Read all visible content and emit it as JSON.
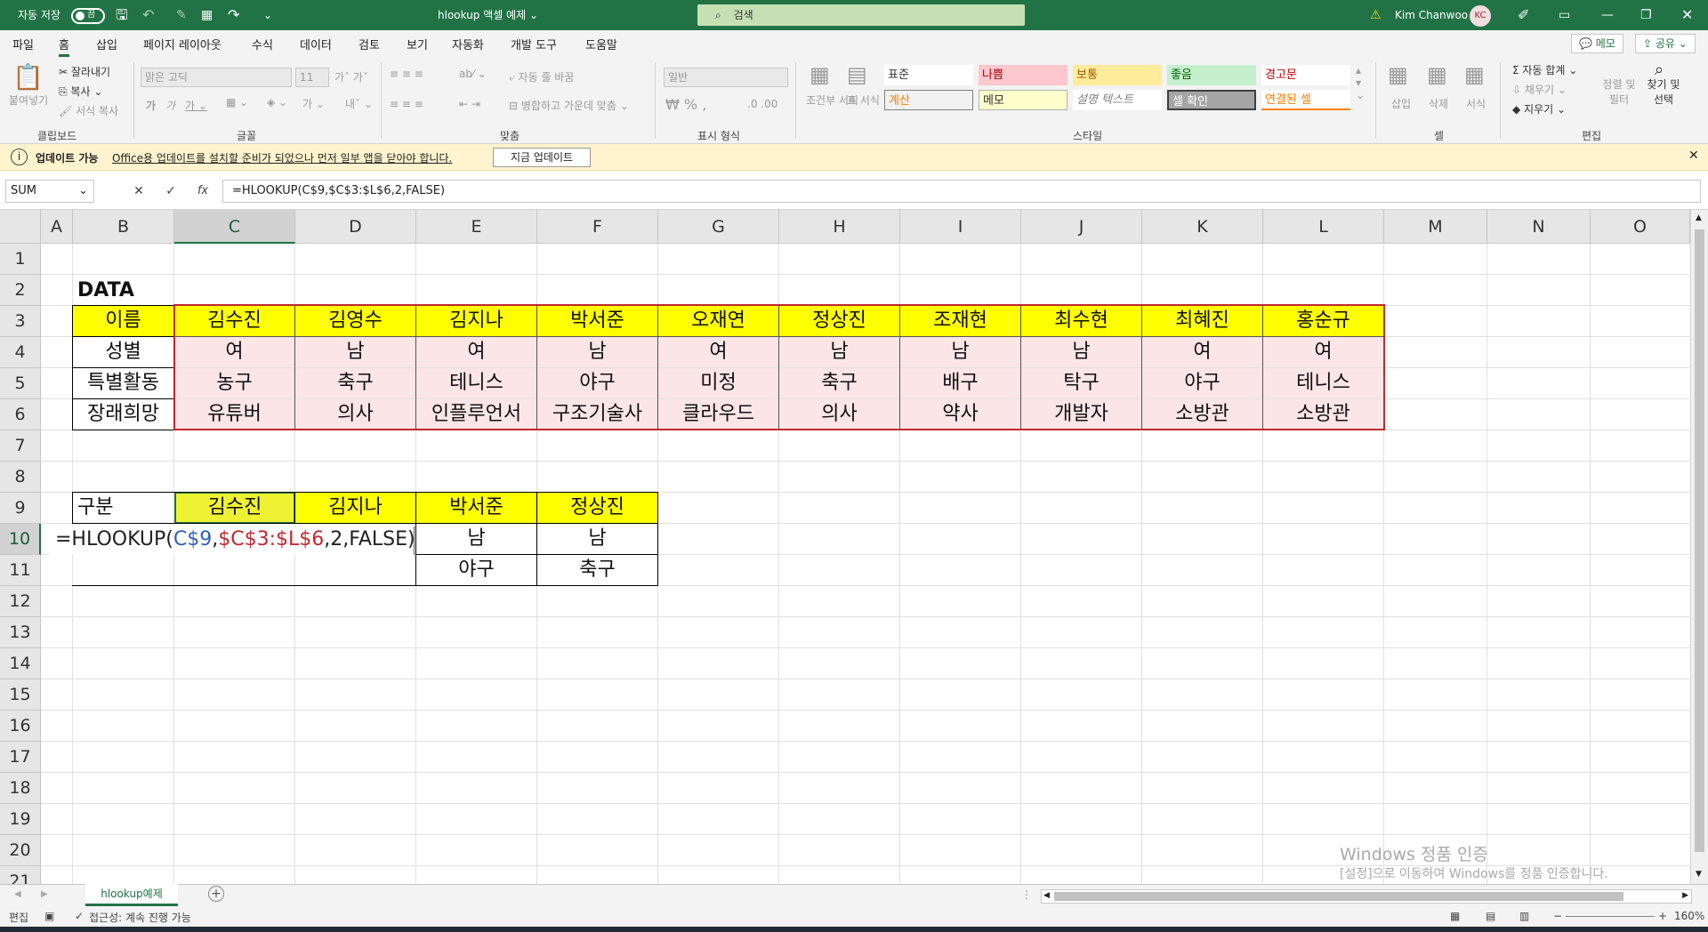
{
  "titlebar": {
    "autosave_label": "자동 저장",
    "autosave_state": "끔",
    "doc_title": "hlookup 액셀 예제",
    "search_placeholder": "검색",
    "user_name": "Kim Chanwoo",
    "user_initials": "KC"
  },
  "menu": {
    "tabs": [
      "파일",
      "홈",
      "삽입",
      "페이지 레이아웃",
      "수식",
      "데이터",
      "검토",
      "보기",
      "자동화",
      "개발 도구",
      "도움말"
    ],
    "active_tab": "홈",
    "memo_button": "메모",
    "share_button": "공유"
  },
  "ribbon": {
    "clipboard": {
      "paste": "붙여넣기",
      "cut": "잘라내기",
      "copy": "복사",
      "format_painter": "서식 복사",
      "label": "클립보드"
    },
    "font": {
      "font_name": "맑은 고딕",
      "font_size": "11",
      "label": "글꼴"
    },
    "align": {
      "wrap": "자동 줄 바꿈",
      "merge": "병합하고 가운데 맞춤",
      "label": "맞춤"
    },
    "number": {
      "format": "일반",
      "label": "표시 형식"
    },
    "styles": {
      "conditional": "조건부 서식",
      "table": "표 서식",
      "cells": [
        "표준",
        "나쁨",
        "보통",
        "좋음",
        "경고문",
        "계산",
        "메모",
        "설명 텍스트",
        "셀 확인",
        "연결된 셀"
      ],
      "label": "스타일"
    },
    "cells_group": {
      "insert": "삽입",
      "delete": "삭제",
      "format": "서식",
      "label": "셀"
    },
    "editing": {
      "autosum": "자동 합계",
      "fill": "채우기",
      "clear": "지우기",
      "sort_filter": "정렬 및 필터",
      "find_select": "찾기 및 선택",
      "label": "편집"
    }
  },
  "infobar": {
    "title": "업데이트 가능",
    "message": "Office용 업데이트를 설치할 준비가 되었으나 먼저 일부 앱을 닫아야 합니다.",
    "button": "지금 업데이트"
  },
  "formula_bar": {
    "name_box": "SUM",
    "cancel": "✕",
    "enter": "✓",
    "fx": "fx",
    "formula": "=HLOOKUP(C$9,$C$3:$L$6,2,FALSE)"
  },
  "columns": [
    "A",
    "B",
    "C",
    "D",
    "E",
    "F",
    "G",
    "H",
    "I",
    "J",
    "K",
    "L",
    "M",
    "N",
    "O"
  ],
  "rows": [
    "1",
    "2",
    "3",
    "4",
    "5",
    "6",
    "7",
    "8",
    "9",
    "10",
    "11",
    "12",
    "13",
    "14",
    "15",
    "16",
    "17",
    "18",
    "19",
    "20",
    "21"
  ],
  "sheet": {
    "data_title": "DATA",
    "table_rows": [
      [
        "이름",
        "김수진",
        "김영수",
        "김지나",
        "박서준",
        "오재연",
        "정상진",
        "조재현",
        "최수현",
        "최혜진",
        "홍순규"
      ],
      [
        "성별",
        "여",
        "남",
        "여",
        "남",
        "여",
        "남",
        "남",
        "남",
        "여",
        "여"
      ],
      [
        "특별활동",
        "농구",
        "축구",
        "테니스",
        "야구",
        "미정",
        "축구",
        "배구",
        "탁구",
        "야구",
        "테니스"
      ],
      [
        "장래희망",
        "유튜버",
        "의사",
        "인플루언서",
        "구조기술사",
        "클라우드",
        "의사",
        "약사",
        "개발자",
        "소방관",
        "소방관"
      ]
    ],
    "lookup_header": [
      "구분",
      "김수진",
      "김지나",
      "박서준",
      "정상진"
    ],
    "row10_values": [
      "",
      "",
      "",
      "남",
      "남"
    ],
    "row11_values": [
      "",
      "",
      "",
      "야구",
      "축구"
    ],
    "editing_formula": {
      "prefix": "=HLOOKUP(",
      "ref1": "C$9",
      "comma1": ",",
      "ref2": "$C$3:$L$6",
      "rest": ",2,FALSE)"
    }
  },
  "watermark": {
    "line1": "Windows 정품 인증",
    "line2": "[설정]으로 이동하여 Windows를 정품 인증합니다."
  },
  "sheet_tabs": {
    "active": "hlookup예제",
    "add": "+"
  },
  "status": {
    "mode": "편집",
    "accessibility": "접근성: 계속 진행 가능",
    "zoom": "160%"
  },
  "colors": {
    "excel_green": "#217346",
    "table_yellow": "#ffff00",
    "table_pink": "#fbe5e6",
    "ref_blue": "#2e5fbf",
    "ref_red": "#c0282f"
  }
}
